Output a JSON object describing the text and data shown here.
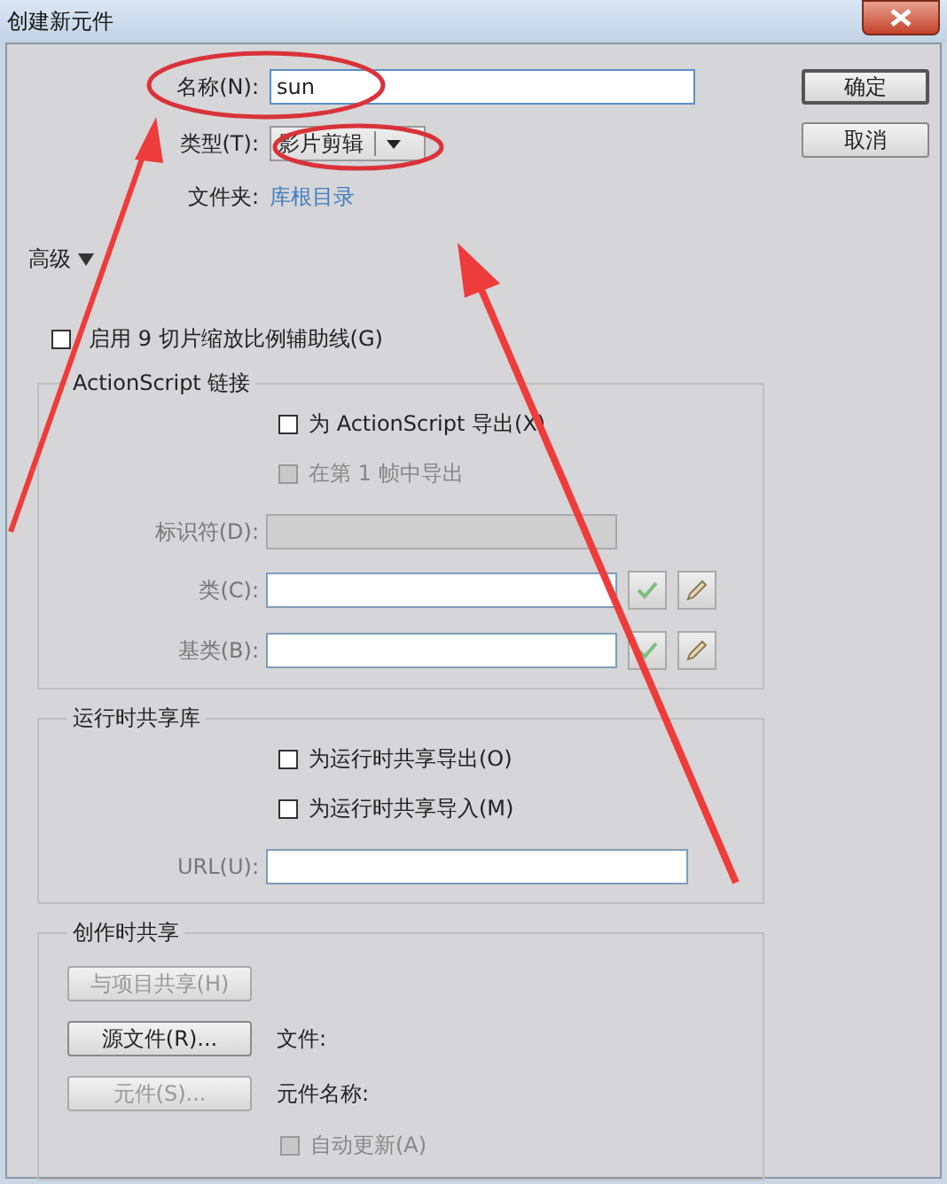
{
  "window": {
    "title": "创建新元件"
  },
  "name_field": {
    "label": "名称(N):",
    "value": "sun"
  },
  "type_field": {
    "label": "类型(T):",
    "value": "影片剪辑"
  },
  "folder": {
    "label": "文件夹:",
    "value": "库根目录"
  },
  "buttons": [
    {
      "label": "确定",
      "default": true
    },
    {
      "label": "取消",
      "default": false
    }
  ],
  "advanced": {
    "label": "高级",
    "expanded": true
  },
  "enable_9slice": {
    "label": "启用 9 切片缩放比例辅助线(G)",
    "checked": false
  },
  "actionscript": {
    "title": "ActionScript 链接",
    "options": [
      {
        "label": "为 ActionScript 导出(X)",
        "checked": false,
        "disabled": false
      },
      {
        "label": "在第 1 帧中导出",
        "checked": false,
        "disabled": true
      }
    ],
    "fields": [
      {
        "label": "标识符(D):",
        "disabled": true,
        "tools": false
      },
      {
        "label": "类(C):",
        "disabled": false,
        "tools": true
      },
      {
        "label": "基类(B):",
        "disabled": false,
        "tools": true
      }
    ]
  },
  "runtime": {
    "title": "运行时共享库",
    "options": [
      {
        "label": "为运行时共享导出(O)",
        "checked": false,
        "disabled": false
      },
      {
        "label": "为运行时共享导入(M)",
        "checked": false,
        "disabled": false
      }
    ],
    "url": {
      "label": "URL(U):"
    }
  },
  "authoring": {
    "title": "创作时共享",
    "rows": [
      {
        "button": "与项目共享(H)",
        "disabled": true
      },
      {
        "button": "源文件(R)...",
        "disabled": false,
        "info": "文件:"
      },
      {
        "button": "元件(S)...",
        "disabled": true,
        "info": "元件名称:"
      }
    ],
    "auto_update": {
      "label": "自动更新(A)",
      "checked": false,
      "disabled": true
    }
  }
}
